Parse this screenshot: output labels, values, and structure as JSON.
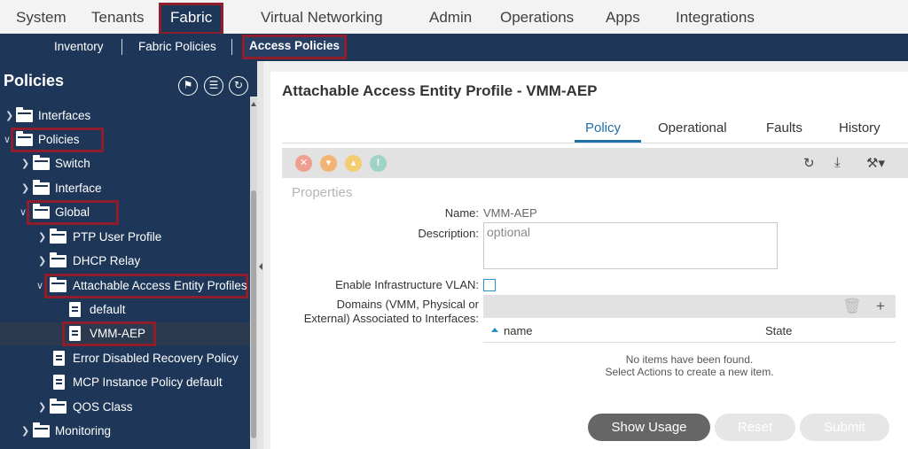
{
  "topnav": {
    "tabs": [
      "System",
      "Tenants",
      "Fabric",
      "Virtual Networking",
      "Admin",
      "Operations",
      "Apps",
      "Integrations"
    ]
  },
  "subnav": {
    "items": [
      "Inventory",
      "Fabric Policies",
      "Access Policies"
    ]
  },
  "sidebar": {
    "title": "Policies",
    "tree": [
      "Interfaces",
      "Policies",
      "Switch",
      "Interface",
      "Global",
      "PTP User Profile",
      "DHCP Relay",
      "Attachable Access Entity Profiles",
      "default",
      "VMM-AEP",
      "Error Disabled Recovery Policy",
      "MCP Instance Policy default",
      "QOS Class",
      "Monitoring"
    ]
  },
  "main": {
    "title": "Attachable Access Entity Profile - VMM-AEP",
    "tabs": [
      "Policy",
      "Operational",
      "Faults",
      "History"
    ],
    "properties_heading": "Properties",
    "name_label": "Name:",
    "name_value": "VMM-AEP",
    "description_label": "Description:",
    "description_placeholder": "optional",
    "infra_vlan_label": "Enable Infrastructure VLAN:",
    "domains_label_line1": "Domains (VMM, Physical or",
    "domains_label_line2": "External) Associated to Interfaces:",
    "grid_columns": [
      "name",
      "State"
    ],
    "empty_line1": "No items have been found.",
    "empty_line2": "Select Actions to create a new item.",
    "buttons": {
      "show_usage": "Show Usage",
      "reset": "Reset",
      "submit": "Submit"
    }
  },
  "colors": {
    "nav_blue": "#1e3658",
    "active_tab": "#1d6fa5",
    "highlight": "#8f1d2c"
  }
}
